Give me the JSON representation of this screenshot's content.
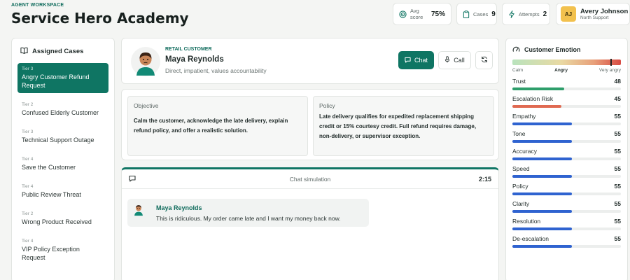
{
  "header": {
    "eyebrow": "AGENT WORKSPACE",
    "title": "Service Hero Academy"
  },
  "stats": {
    "avg_score": {
      "label": "Avg score",
      "value": "75%",
      "icon": "target-icon"
    },
    "cases": {
      "label": "Cases",
      "value": "9",
      "icon": "clipboard-icon"
    },
    "attempts": {
      "label": "Attempts",
      "value": "2",
      "icon": "bolt-icon"
    }
  },
  "profile": {
    "initials": "AJ",
    "name": "Avery Johnson",
    "team": "North Support"
  },
  "sidebar": {
    "title": "Assigned Cases",
    "cases": [
      {
        "tier": "Tier 3",
        "title": "Angry Customer Refund Request",
        "active": true
      },
      {
        "tier": "Tier 2",
        "title": "Confused Elderly Customer",
        "active": false
      },
      {
        "tier": "Tier 3",
        "title": "Technical Support Outage",
        "active": false
      },
      {
        "tier": "Tier 4",
        "title": "Save the Customer",
        "active": false
      },
      {
        "tier": "Tier 4",
        "title": "Public Review Threat",
        "active": false
      },
      {
        "tier": "Tier 2",
        "title": "Wrong Product Received",
        "active": false
      },
      {
        "tier": "Tier 4",
        "title": "VIP Policy Exception Request",
        "active": false
      }
    ]
  },
  "customer": {
    "eyebrow": "RETAIL CUSTOMER",
    "name": "Maya Reynolds",
    "description": "Direct, impatient, values accountability",
    "chat_label": "Chat",
    "call_label": "Call"
  },
  "objective": {
    "heading": "Objective",
    "text": "Calm the customer, acknowledge the late delivery, explain refund policy, and offer a realistic solution."
  },
  "policy": {
    "heading": "Policy",
    "text": "Late delivery qualifies for expedited replacement shipping credit or 15% courtesy credit. Full refund requires damage, non-delivery, or supervisor exception."
  },
  "chat": {
    "title": "Chat simulation",
    "timer": "2:15",
    "messages": [
      {
        "sender": "Maya Reynolds",
        "text": "This is ridiculous. My order came late and I want my money back now."
      }
    ]
  },
  "emotion": {
    "title": "Customer Emotion",
    "level": 0.9,
    "scale_low": "Calm",
    "scale_mid": "Angry",
    "scale_high": "Very angry",
    "metrics": [
      {
        "label": "Trust",
        "value": 48,
        "color": "#2e9e6b"
      },
      {
        "label": "Escalation Risk",
        "value": 45,
        "color": "#e06a52"
      },
      {
        "label": "Empathy",
        "value": 55,
        "color": "#2f63d0"
      },
      {
        "label": "Tone",
        "value": 55,
        "color": "#2f63d0"
      },
      {
        "label": "Accuracy",
        "value": 55,
        "color": "#2f63d0"
      },
      {
        "label": "Speed",
        "value": 55,
        "color": "#2f63d0"
      },
      {
        "label": "Policy",
        "value": 55,
        "color": "#2f63d0"
      },
      {
        "label": "Clarity",
        "value": 55,
        "color": "#2f63d0"
      },
      {
        "label": "Resolution",
        "value": 55,
        "color": "#2f63d0"
      },
      {
        "label": "De-escalation",
        "value": 55,
        "color": "#2f63d0"
      }
    ]
  },
  "colors": {
    "accent": "#0f7563",
    "accent_text": "#0f6b5c",
    "trust": "#2e9e6b",
    "risk": "#e06a52",
    "metric": "#2f63d0"
  }
}
